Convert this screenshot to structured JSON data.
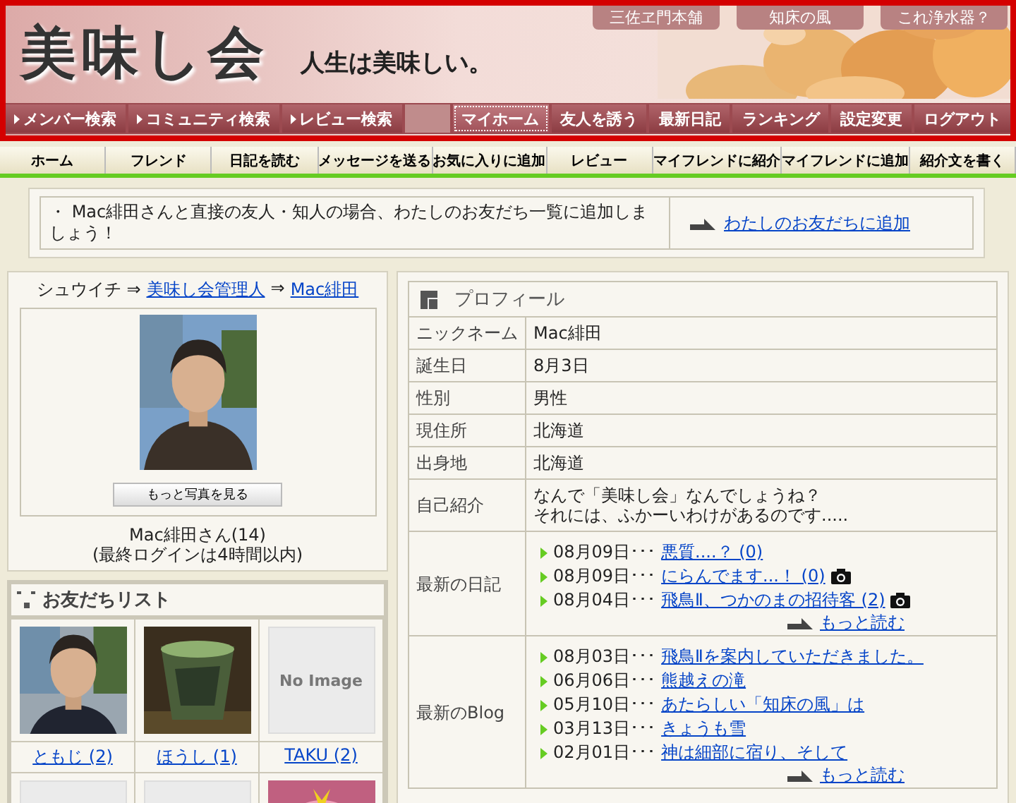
{
  "header": {
    "logo": "美味し会",
    "tagline": "人生は美味しい。",
    "top_links": [
      "三佐ヱ門本舗",
      "知床の風",
      "これ浄水器？"
    ],
    "nav": [
      {
        "label": "メンバー検索",
        "kind": "search",
        "selected": false
      },
      {
        "label": "コミュニティ検索",
        "kind": "search",
        "selected": false
      },
      {
        "label": "レビュー検索",
        "kind": "search",
        "selected": false
      },
      {
        "kind": "spacer"
      },
      {
        "label": "マイホーム",
        "kind": "main",
        "selected": true
      },
      {
        "label": "友人を誘う",
        "kind": "main",
        "selected": false
      },
      {
        "label": "最新日記",
        "kind": "main",
        "selected": false
      },
      {
        "label": "ランキング",
        "kind": "main",
        "selected": false
      },
      {
        "label": "設定変更",
        "kind": "main",
        "selected": false
      },
      {
        "label": "ログアウト",
        "kind": "main",
        "selected": false
      }
    ]
  },
  "subnav": [
    "ホーム",
    "フレンド",
    "日記を読む",
    "メッセージを送る",
    "お気に入りに追加",
    "レビュー",
    "マイフレンドに紹介",
    "マイフレンドに追加",
    "紹介文を書く"
  ],
  "notice": {
    "message": "・ Mac緋田さんと直接の友人・知人の場合、わたしのお友だち一覧に追加しましょう！",
    "link": "わたしのお友だちに追加"
  },
  "member": {
    "breadcrumb": [
      {
        "kind": "text",
        "text": "シュウイチ ⇒"
      },
      {
        "kind": "link",
        "text": "美味し会管理人"
      },
      {
        "kind": "text",
        "text": "⇒"
      },
      {
        "kind": "link",
        "text": "Mac緋田"
      }
    ],
    "photo_button": "もっと写真を見る",
    "name": "Mac緋田さん(14)",
    "last_login": "(最終ログインは4時間以内)"
  },
  "friends": {
    "title": "お友だちリスト",
    "items": [
      {
        "kind": "person",
        "name": "ともじ (2)"
      },
      {
        "kind": "cup",
        "name": "ほうし (1)"
      },
      {
        "kind": "noimage",
        "placeholder_text": "No Image",
        "name": "TAKU (2)"
      },
      {
        "kind": "blank"
      },
      {
        "kind": "blank"
      },
      {
        "kind": "cake"
      }
    ]
  },
  "profile": {
    "title": "プロフィール",
    "rows": [
      {
        "label": "ニックネーム",
        "lines": [
          "Mac緋田"
        ]
      },
      {
        "label": "誕生日",
        "lines": [
          "8月3日"
        ]
      },
      {
        "label": "性別",
        "lines": [
          "男性"
        ]
      },
      {
        "label": "現住所",
        "lines": [
          "北海道"
        ]
      },
      {
        "label": "出身地",
        "lines": [
          "北海道"
        ]
      },
      {
        "label": "自己紹介",
        "lines": [
          "なんで「美味し会」なんでしょうね？",
          "それには、ふかーいわけがあるのです....."
        ]
      }
    ],
    "lists": [
      {
        "label": "最新の日記",
        "more": "もっと読む",
        "entries": [
          {
            "date": "08月09日･･･",
            "title": "悪質....？ (0)",
            "photo": false
          },
          {
            "date": "08月09日･･･",
            "title": "にらんでます...！ (0)",
            "photo": true
          },
          {
            "date": "08月04日･･･",
            "title": "飛鳥Ⅱ、つかのまの招待客 (2)",
            "photo": true
          }
        ]
      },
      {
        "label": "最新のBlog",
        "more": "もっと読む",
        "entries": [
          {
            "date": "08月03日･･･",
            "title": "飛鳥Ⅱを案内していただきました。",
            "photo": false
          },
          {
            "date": "06月06日･･･",
            "title": "熊越えの滝",
            "photo": false
          },
          {
            "date": "05月10日･･･",
            "title": "あたらしい「知床の風」は",
            "photo": false
          },
          {
            "date": "03月13日･･･",
            "title": "きょうも雪",
            "photo": false
          },
          {
            "date": "02月01日･･･",
            "title": "神は細部に宿り、そして",
            "photo": false
          }
        ]
      }
    ]
  }
}
